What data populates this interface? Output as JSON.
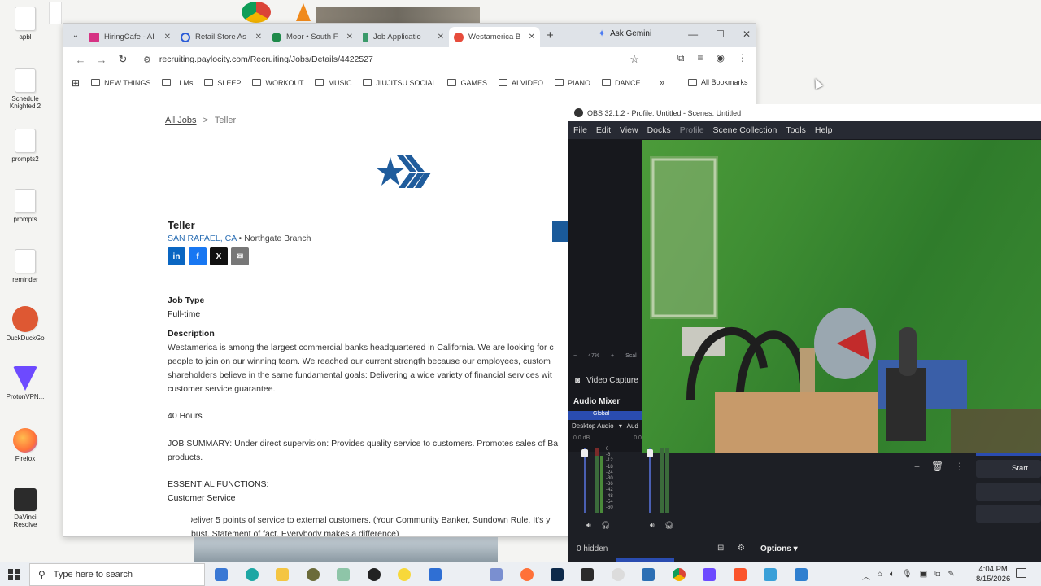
{
  "desktop": {
    "icons": [
      {
        "label": "apbl",
        "color": "#ffffff"
      },
      {
        "label": "Schedule\nKnighted 2",
        "color": "#ffffff"
      },
      {
        "label": "prompts2",
        "color": "#ffffff"
      },
      {
        "label": "prompts",
        "color": "#ffffff"
      },
      {
        "label": "reminder",
        "color": "#ffffff"
      },
      {
        "label": "DuckDuckGo",
        "color": "#de5833"
      },
      {
        "label": "ProtonVPN...",
        "color": "#6d4aff"
      },
      {
        "label": "Firefox",
        "color": "#ff7139"
      },
      {
        "label": "DaVinci\nResolve",
        "color": "#2b2b2b"
      }
    ]
  },
  "chrome": {
    "tabs": [
      {
        "label": "HiringCafe - AI",
        "icon_color": "#d63384",
        "active": false
      },
      {
        "label": "Retail Store As",
        "icon_color": "#2a5bd7",
        "active": false
      },
      {
        "label": "Moor • South F",
        "icon_color": "#1e8a4a",
        "active": false
      },
      {
        "label": "Job Applicatio",
        "icon_color": "#3a9a6a",
        "active": false
      },
      {
        "label": "Westamerica B",
        "icon_color": "#e74c3c",
        "active": true
      }
    ],
    "ask_gemini": "Ask Gemini",
    "url": "recruiting.paylocity.com/Recruiting/Jobs/Details/4422527",
    "bookmarks": [
      "NEW THINGS",
      "LLMs",
      "SLEEP",
      "WORKOUT",
      "MUSIC",
      "JIUJITSU SOCIAL",
      "GAMES",
      "AI VIDEO",
      "PIANO",
      "DANCE"
    ],
    "all_bookmarks": "All Bookmarks"
  },
  "job": {
    "breadcrumb_link": "All Jobs",
    "breadcrumb_sep": ">",
    "breadcrumb_current": "Teller",
    "title": "Teller",
    "city": "SAN RAFAEL, CA",
    "branch": "• Northgate Branch",
    "share": [
      "in",
      "f",
      "X",
      "✉"
    ],
    "job_type_label": "Job Type",
    "job_type": "Full-time",
    "description_label": "Description",
    "description_lines": [
      "Westamerica is among the largest commercial banks headquartered in California. We are looking for c",
      "people to join on our winning team. We reached our current strength because our employees, custom",
      "shareholders believe in the same fundamental goals: Delivering a wide variety of financial services wit",
      "customer service guarantee."
    ],
    "hours": "40 Hours",
    "summary_lines": [
      "JOB SUMMARY: Under direct supervision: Provides quality service to customers. Promotes sales of Ba",
      "products."
    ],
    "essential_label": "ESSENTIAL FUNCTIONS:",
    "customer_service": "Customer Service",
    "bullet_lines": [
      "• Deliver 5 points of service to external customers. (Your Community Banker, Sundown Rule, It's y",
      "bust, Statement of fact, Everybody makes a difference)"
    ]
  },
  "obs": {
    "title": "OBS 32.1.2 - Profile: Untitled - Scenes: Untitled",
    "menu": [
      "File",
      "Edit",
      "View",
      "Docks",
      "Profile",
      "Scene Collection",
      "Tools",
      "Help"
    ],
    "zoom": "47%",
    "zoom_extra": "Scal",
    "video_capture": "Video Capture",
    "audio_mixer": "Audio Mixer",
    "mixer_tab": "Global",
    "channel": "Desktop Audio",
    "channel2": "Aud",
    "db": "0.0 dB",
    "db2": "0.0",
    "ticks": [
      "0",
      "-6",
      "-12",
      "-18",
      "-24",
      "-30",
      "-36",
      "-42",
      "-48",
      "-54",
      "-60"
    ],
    "hidden": "0 hidden",
    "options": "Options",
    "start": "Start"
  },
  "taskbar": {
    "search_placeholder": "Type here to search",
    "time": "4:04 PM",
    "date": "8/15/2026"
  }
}
